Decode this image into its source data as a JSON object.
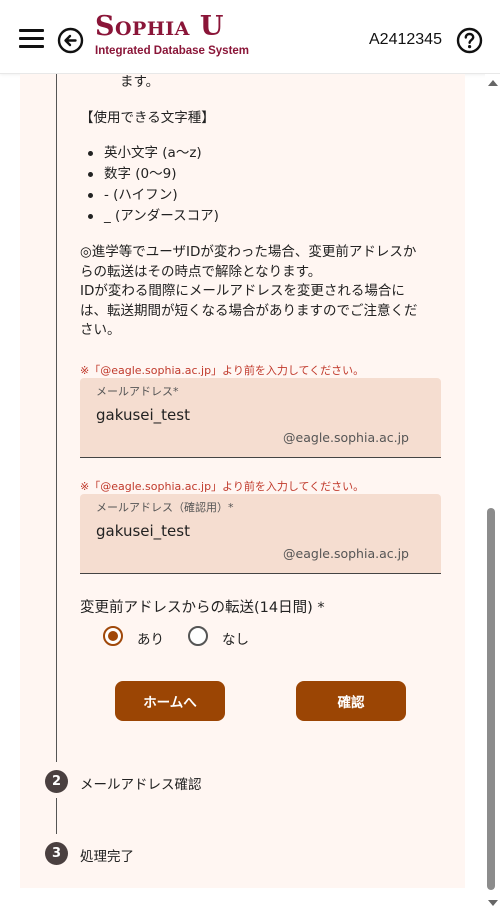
{
  "header": {
    "logo_title": "Sophia U",
    "logo_subtitle": "Integrated Database System",
    "user_id": "A2412345"
  },
  "content": {
    "intro_tail": "ます。",
    "charset_heading": "【使用できる文字種】",
    "charset_items": [
      "英小文字 (a〜z)",
      "数字 (0〜9)",
      "- (ハイフン)",
      "_ (アンダースコア)"
    ],
    "notice_lines": [
      "◎進学等でユーザIDが変わった場合、変更前アドレスか",
      "らの転送はその時点で解除となります。",
      "IDが変わる間際にメールアドレスを変更される場合に",
      "は、転送期間が短くなる場合がありますのでご注意くだ",
      "さい。"
    ]
  },
  "form": {
    "email": {
      "note": "※「@eagle.sophia.ac.jp」より前を入力してください。",
      "label": "メールアドレス*",
      "value": "gakusei_test",
      "suffix": "@eagle.sophia.ac.jp"
    },
    "email_confirm": {
      "note": "※「@eagle.sophia.ac.jp」より前を入力してください。",
      "label": "メールアドレス（確認用）*",
      "value": "gakusei_test",
      "suffix": "@eagle.sophia.ac.jp"
    },
    "forward": {
      "label": "変更前アドレスからの転送(14日間) *",
      "options": [
        "あり",
        "なし"
      ],
      "selected": "あり"
    },
    "buttons": {
      "home": "ホームへ",
      "confirm": "確認"
    }
  },
  "steps": [
    {
      "number": "2",
      "label": "メールアドレス確認"
    },
    {
      "number": "3",
      "label": "処理完了"
    }
  ],
  "colors": {
    "brand": "#8a1538",
    "accent": "#9b4504",
    "panel_bg": "#fff6f2",
    "field_bg": "#f5ddd0",
    "note_red": "#c0392b"
  },
  "icons": [
    "menu-icon",
    "back-arrow-icon",
    "help-icon"
  ]
}
